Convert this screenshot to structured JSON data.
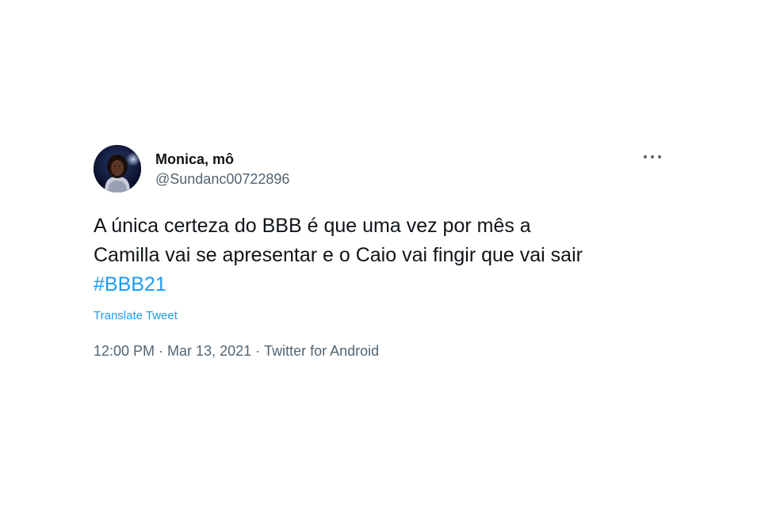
{
  "tweet": {
    "author": {
      "display_name": "Monica, mô",
      "handle": "@Sundanc00722896"
    },
    "text_lines": [
      "A única certeza do BBB é que uma vez por mês a",
      "Camilla vai se apresentar e o Caio vai fingir que vai sair"
    ],
    "hashtag": "#BBB21",
    "translate_label": "Translate Tweet",
    "time": "12:00 PM",
    "date": "Mar 13, 2021",
    "separator": "·",
    "source": "Twitter for Android",
    "more_icon": "more-horizontal-icon"
  },
  "colors": {
    "link": "#1d9bf0",
    "secondary_text": "#536471",
    "primary_text": "#0f1419",
    "background": "#ffffff"
  }
}
